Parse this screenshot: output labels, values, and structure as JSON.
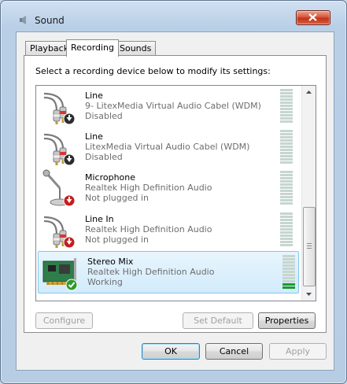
{
  "window": {
    "title": "Sound",
    "icon": "speaker-icon"
  },
  "tabs": [
    {
      "label": "Playback",
      "active": false
    },
    {
      "label": "Recording",
      "active": true
    },
    {
      "label": "Sounds",
      "active": false
    }
  ],
  "instruction": "Select a recording device below to modify its settings:",
  "devices": [
    {
      "name": "Line",
      "driver": "9- LitexMedia Virtual Audio Cabel (WDM)",
      "status": "Disabled",
      "icon": "rca-cable-icon",
      "badge": "down-arrow-badge",
      "meter_level": 0
    },
    {
      "name": "Line",
      "driver": "LitexMedia Virtual Audio Cabel (WDM)",
      "status": "Disabled",
      "icon": "rca-cable-icon",
      "badge": "down-arrow-badge",
      "meter_level": 0
    },
    {
      "name": "Microphone",
      "driver": "Realtek High Definition Audio",
      "status": "Not plugged in",
      "icon": "microphone-icon",
      "badge": "red-down-arrow-badge",
      "meter_level": 0
    },
    {
      "name": "Line In",
      "driver": "Realtek High Definition Audio",
      "status": "Not plugged in",
      "icon": "rca-cable-icon",
      "badge": "red-down-arrow-badge",
      "meter_level": 0
    },
    {
      "name": "Stereo Mix",
      "driver": "Realtek High Definition Audio",
      "status": "Working",
      "icon": "sound-card-icon",
      "badge": "green-check-badge",
      "meter_level": 0.2,
      "selected": true
    }
  ],
  "buttons": {
    "configure": "Configure",
    "set_default": "Set Default",
    "properties": "Properties",
    "ok": "OK",
    "cancel": "Cancel",
    "apply": "Apply"
  },
  "colors": {
    "meter_active": "#1a9b2c",
    "meter_inactive": "#c6d6cf",
    "selection": "#d2ebfb"
  }
}
